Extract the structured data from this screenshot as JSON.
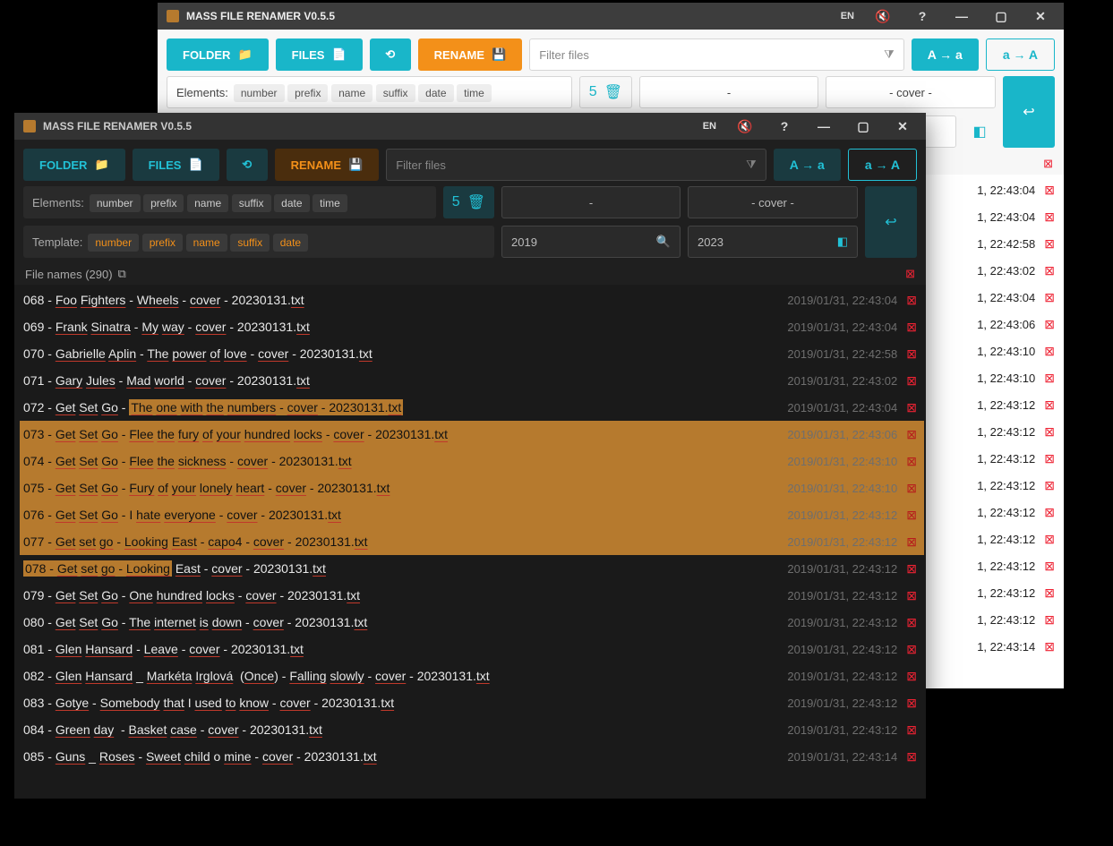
{
  "title": "MASS FILE RENAMER V0.5.5",
  "lang": "EN",
  "toolbar": {
    "folder": "FOLDER",
    "files": "FILES",
    "rename": "RENAME",
    "filter_ph": "Filter files",
    "case_lower": "A → a",
    "case_upper": "a → A"
  },
  "elements": {
    "label": "Elements:",
    "chips": [
      "number",
      "prefix",
      "name",
      "suffix",
      "date",
      "time"
    ],
    "count": "5",
    "sep": "-",
    "suffix": "- cover -"
  },
  "template": {
    "label": "Template:",
    "chips": [
      "number",
      "prefix",
      "name",
      "suffix",
      "date"
    ],
    "search": "2019",
    "replace": "2023"
  },
  "header": {
    "label_dark": "File names (290)"
  },
  "light_rows": [
    {
      "date": "1, 22:43:04"
    },
    {
      "date": "1, 22:43:04"
    },
    {
      "date": "1, 22:42:58"
    },
    {
      "date": "1, 22:43:02"
    },
    {
      "date": "1, 22:43:04"
    },
    {
      "date": "1, 22:43:06"
    },
    {
      "date": "1, 22:43:10"
    },
    {
      "date": "1, 22:43:10"
    },
    {
      "date": "1, 22:43:12"
    },
    {
      "date": "1, 22:43:12"
    },
    {
      "date": "1, 22:43:12"
    },
    {
      "date": "1, 22:43:12"
    },
    {
      "date": "1, 22:43:12"
    },
    {
      "date": "1, 22:43:12"
    },
    {
      "date": "1, 22:43:12"
    },
    {
      "date": "1, 22:43:12"
    },
    {
      "date": "1, 22:43:12"
    },
    {
      "date": "1, 22:43:14"
    }
  ],
  "dark_rows": [
    {
      "n": "068",
      "txt": " - Foo Fighters - Wheels - cover - 20230131.txt",
      "date": "2019/01/31, 22:43:04",
      "sel": 0
    },
    {
      "n": "069",
      "txt": " - Frank Sinatra - My way - cover - 20230131.txt",
      "date": "2019/01/31, 22:43:04",
      "sel": 0
    },
    {
      "n": "070",
      "txt": " - Gabrielle Aplin - The power of love - cover - 20230131.txt",
      "date": "2019/01/31, 22:42:58",
      "sel": 0
    },
    {
      "n": "071",
      "txt": " - Gary Jules - Mad world - cover - 20230131.txt",
      "date": "2019/01/31, 22:43:02",
      "sel": 0
    },
    {
      "n": "072",
      "txt": " - Get Set Go - The one with the numbers - cover - 20230131.txt",
      "date": "2019/01/31, 22:43:04",
      "sel": 2
    },
    {
      "n": "073",
      "txt": " - Get Set Go - Flee the fury of your hundred locks - cover - 20230131.txt",
      "date": "2019/01/31, 22:43:06",
      "sel": 1
    },
    {
      "n": "074",
      "txt": " - Get Set Go - Flee the sickness - cover - 20230131.txt",
      "date": "2019/01/31, 22:43:10",
      "sel": 1
    },
    {
      "n": "075",
      "txt": " - Get Set Go - Fury of your lonely heart - cover - 20230131.txt",
      "date": "2019/01/31, 22:43:10",
      "sel": 1
    },
    {
      "n": "076",
      "txt": " - Get Set Go - I hate everyone - cover - 20230131.txt",
      "date": "2019/01/31, 22:43:12",
      "sel": 1
    },
    {
      "n": "077",
      "txt": " - Get set go - Looking East - capo4 - cover - 20230131.txt",
      "date": "2019/01/31, 22:43:12",
      "sel": 1
    },
    {
      "n": "078",
      "txt": " - Get set go - Looking East - cover - 20230131.txt",
      "date": "2019/01/31, 22:43:12",
      "sel": 3
    },
    {
      "n": "079",
      "txt": " - Get Set Go - One hundred locks - cover - 20230131.txt",
      "date": "2019/01/31, 22:43:12",
      "sel": 0
    },
    {
      "n": "080",
      "txt": " - Get Set Go - The internet is down - cover - 20230131.txt",
      "date": "2019/01/31, 22:43:12",
      "sel": 0
    },
    {
      "n": "081",
      "txt": " - Glen Hansard - Leave - cover - 20230131.txt",
      "date": "2019/01/31, 22:43:12",
      "sel": 0
    },
    {
      "n": "082",
      "txt": " - Glen Hansard _ Markéta Irglová  (Once) - Falling slowly - cover - 20230131.txt",
      "date": "2019/01/31, 22:43:12",
      "sel": 0
    },
    {
      "n": "083",
      "txt": " - Gotye - Somebody that I used to know - cover - 20230131.txt",
      "date": "2019/01/31, 22:43:12",
      "sel": 0
    },
    {
      "n": "084",
      "txt": " - Green day  - Basket case - cover - 20230131.txt",
      "date": "2019/01/31, 22:43:12",
      "sel": 0
    },
    {
      "n": "085",
      "txt": " - Guns _ Roses - Sweet child o mine - cover - 20230131.txt",
      "date": "2019/01/31, 22:43:14",
      "sel": 0
    }
  ]
}
